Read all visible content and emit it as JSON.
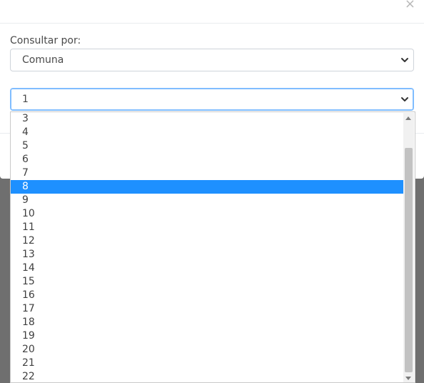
{
  "modal": {
    "close_symbol": "×"
  },
  "form": {
    "label": "Consultar por:",
    "consultar_select": {
      "value": "Comuna"
    },
    "comuna_select": {
      "value": "1"
    }
  },
  "dropdown": {
    "options": [
      "3",
      "4",
      "5",
      "6",
      "7",
      "8",
      "9",
      "10",
      "11",
      "12",
      "13",
      "14",
      "15",
      "16",
      "17",
      "18",
      "19",
      "20",
      "21",
      "22"
    ],
    "selected": "8"
  },
  "icons": {
    "chevron": "chevron-down-icon",
    "close": "close-icon",
    "scroll_up": "scroll-up-icon",
    "scroll_down": "scroll-down-icon"
  },
  "colors": {
    "selected_bg": "#1e90ff",
    "focus_border": "#80bdff",
    "backdrop": "#6f6f6f"
  }
}
